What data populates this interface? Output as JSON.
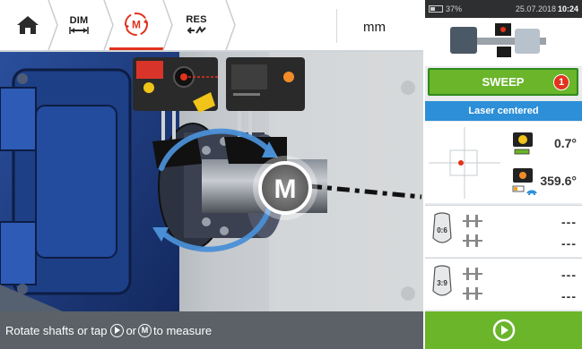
{
  "toolbar": {
    "home_icon": "home-icon",
    "dim_label": "DIM",
    "measure_icon_letter": "M",
    "res_label": "RES",
    "unit": "mm"
  },
  "status_bar": {
    "text_before": "Rotate shafts or tap",
    "text_middle": "or",
    "text_after": "to measure",
    "inline_m": "M"
  },
  "system_bar": {
    "battery": "37%",
    "date": "25.07.2018",
    "time": "10:24"
  },
  "sweep_button": {
    "label": "SWEEP",
    "badge": "1"
  },
  "laser_status": "Laser centered",
  "sensor_readings": {
    "top": "0.7°",
    "bottom": "359.6°"
  },
  "positions": [
    {
      "icon_text": "0:6",
      "values": [
        "---",
        "---"
      ]
    },
    {
      "icon_text": "3:9",
      "values": [
        "---",
        "---"
      ]
    }
  ],
  "overlay_letter": "M",
  "colors": {
    "accent_red": "#e2321d",
    "green": "#6ab52a",
    "blue": "#2c8fd8",
    "status_bar": "#5b6166"
  }
}
